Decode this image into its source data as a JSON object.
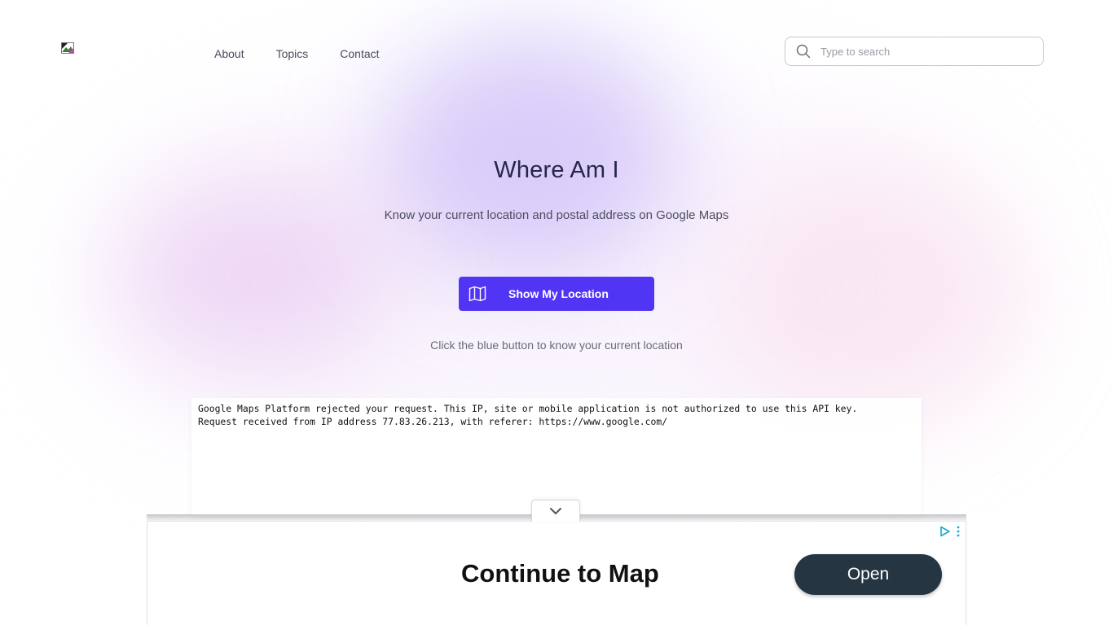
{
  "nav": {
    "items": [
      {
        "label": "About"
      },
      {
        "label": "Topics"
      },
      {
        "label": "Contact"
      }
    ]
  },
  "search": {
    "placeholder": "Type to search",
    "icon": "search-icon"
  },
  "hero": {
    "title": "Where Am I",
    "subtitle": "Know your current location and postal address on Google Maps",
    "button_label": "Show My Location",
    "button_icon": "map-icon",
    "hint": "Click the blue button to know your current location"
  },
  "map": {
    "error_line1": "Google Maps Platform rejected your request. This IP, site or mobile application is not authorized to use this API key.",
    "error_line2": "Request received from IP address 77.83.26.213, with referer: https://www.google.com/"
  },
  "ad": {
    "headline": "Continue to Map",
    "button_label": "Open",
    "collapse_icon": "chevron-down-icon",
    "choices_icon": "ad-choices-icon",
    "menu_icon": "more-vertical-icon"
  },
  "colors": {
    "accent": "#5135f4",
    "title": "#262646",
    "ad_button": "#253541"
  }
}
